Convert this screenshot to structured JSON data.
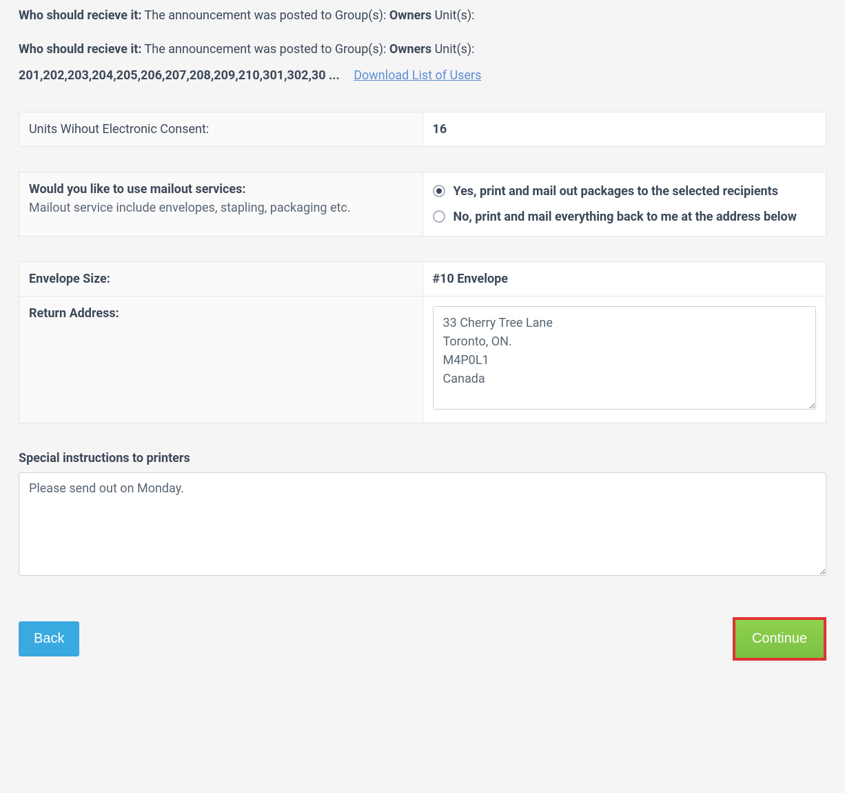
{
  "who1": {
    "label": "Who should recieve it:",
    "text_a": " The announcement was posted to Group(s): ",
    "owners": "Owners",
    "text_b": " Unit(s):"
  },
  "who2": {
    "label": "Who should recieve it:",
    "text_a": " The announcement was posted to Group(s): ",
    "owners": "Owners",
    "text_b": " Unit(s):",
    "units": "201,202,203,204,205,206,207,208,209,210,301,302,30 ...",
    "download": "Download List of Users"
  },
  "consent": {
    "label": "Units Wihout Electronic Consent:",
    "value": "16"
  },
  "mailout": {
    "question": "Would you like to use mailout services:",
    "sub": "Mailout service include envelopes, stapling, packaging etc.",
    "option_yes": "Yes, print and mail out packages to the selected recipients",
    "option_no": "No, print and mail everything back to me at the address below",
    "selected": "yes"
  },
  "envelope": {
    "label": "Envelope Size:",
    "value": "#10 Envelope"
  },
  "return_address": {
    "label": "Return Address:",
    "value": "33 Cherry Tree Lane\nToronto, ON.\nM4P0L1\nCanada"
  },
  "instructions": {
    "label": "Special instructions to printers",
    "value": "Please send out on Monday."
  },
  "buttons": {
    "back": "Back",
    "continue": "Continue"
  }
}
